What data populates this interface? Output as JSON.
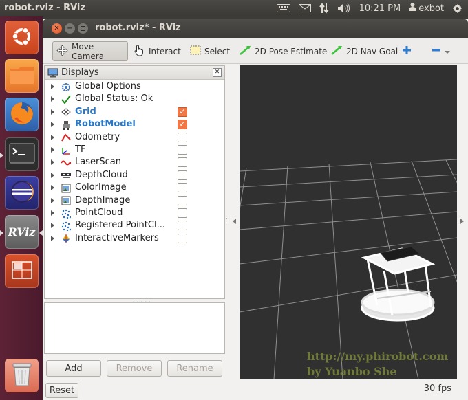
{
  "topbar": {
    "app_title": "robot.rviz - RViz",
    "clock": "10:21 PM",
    "user": "exbot",
    "icons": [
      "keyboard-icon",
      "mail-icon",
      "network-icon",
      "volume-icon",
      "user-icon",
      "settings-gear-icon"
    ]
  },
  "launcher": {
    "items": [
      "ubuntu-dash",
      "files",
      "firefox",
      "terminal",
      "eclipse",
      "rviz",
      "workspace-switcher",
      "trash"
    ],
    "rviz_label": "RViz"
  },
  "window": {
    "title": "robot.rviz* - RViz"
  },
  "toolbar": {
    "move_camera": "Move Camera",
    "interact": "Interact",
    "select": "Select",
    "pose_estimate": "2D Pose Estimate",
    "nav_goal": "2D Nav Goal"
  },
  "displays": {
    "title": "Displays",
    "items": [
      {
        "label": "Global Options",
        "icon": "gear-icon",
        "checkbox": null,
        "bold": false
      },
      {
        "label": "Global Status: Ok",
        "icon": "check-icon",
        "checkbox": null,
        "bold": false
      },
      {
        "label": "Grid",
        "icon": "grid-icon",
        "checkbox": true,
        "bold": true
      },
      {
        "label": "RobotModel",
        "icon": "robot-icon",
        "checkbox": true,
        "bold": true
      },
      {
        "label": "Odometry",
        "icon": "odometry-icon",
        "checkbox": false,
        "bold": false
      },
      {
        "label": "TF",
        "icon": "tf-axes-icon",
        "checkbox": false,
        "bold": false
      },
      {
        "label": "LaserScan",
        "icon": "laserscan-icon",
        "checkbox": false,
        "bold": false
      },
      {
        "label": "DepthCloud",
        "icon": "depthcloud-icon",
        "checkbox": false,
        "bold": false
      },
      {
        "label": "ColorImage",
        "icon": "image-icon",
        "checkbox": false,
        "bold": false
      },
      {
        "label": "DepthImage",
        "icon": "image-icon",
        "checkbox": false,
        "bold": false
      },
      {
        "label": "PointCloud",
        "icon": "pointcloud-icon",
        "checkbox": false,
        "bold": false
      },
      {
        "label": "Registered PointCl...",
        "icon": "pointcloud-icon",
        "checkbox": false,
        "bold": false
      },
      {
        "label": "InteractiveMarkers",
        "icon": "interactive-markers-icon",
        "checkbox": false,
        "bold": false
      }
    ]
  },
  "buttons": {
    "add": "Add",
    "remove": "Remove",
    "rename": "Rename",
    "reset": "Reset"
  },
  "viewport": {
    "watermark_line1": "http://my.phirobot.com",
    "watermark_line2": "by Yuanbo She"
  },
  "status": {
    "fps": "30 fps"
  },
  "colors": {
    "launcher_bg": "#5e2236",
    "viewport_bg": "#303030",
    "checkbox_checked": "#f07746",
    "display_bold": "#2a78c6"
  }
}
